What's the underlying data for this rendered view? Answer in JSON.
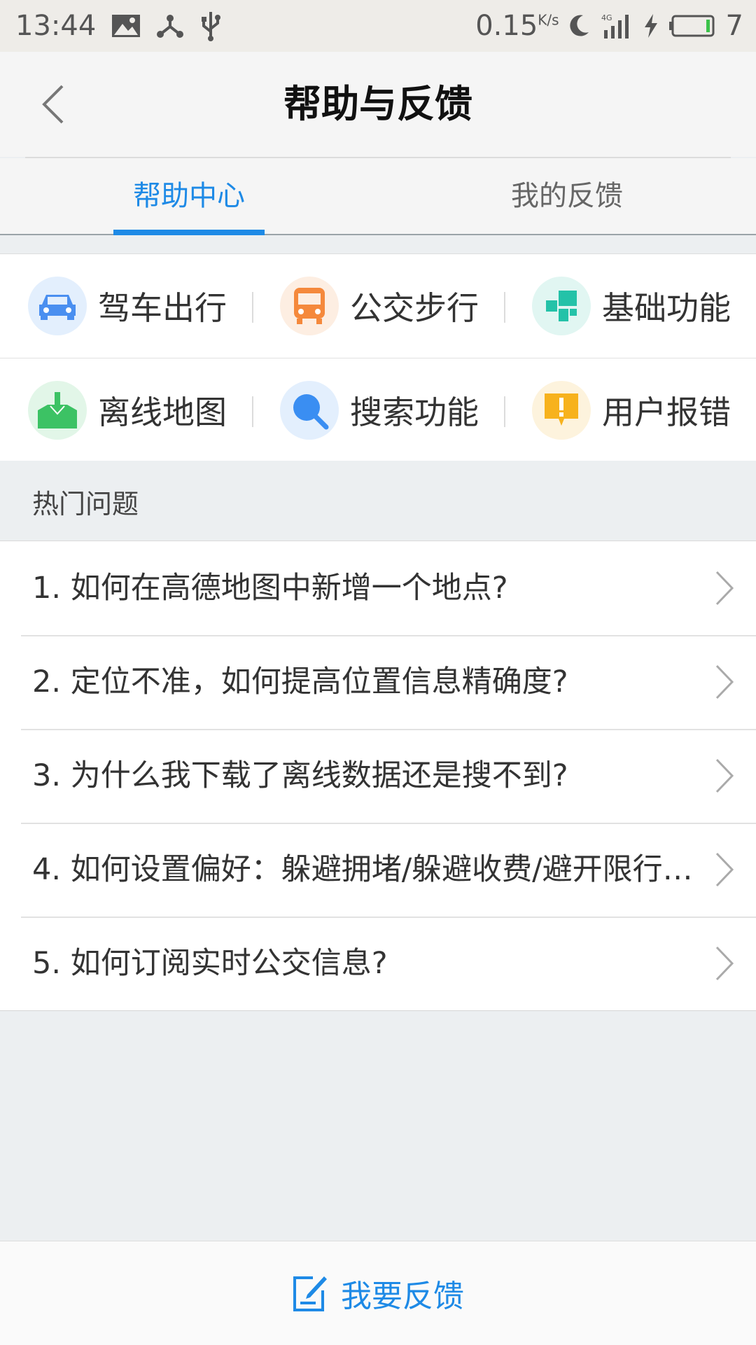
{
  "status_bar": {
    "time": "13:44",
    "speed": "0.15",
    "speed_unit": "K/s",
    "battery": "7",
    "network": "4G",
    "icons": [
      "image-icon",
      "share-node-icon",
      "usb-icon",
      "moon-icon",
      "signal-icon",
      "charging-icon",
      "battery-icon"
    ]
  },
  "header": {
    "title": "帮助与反馈",
    "back_icon": "chevron-left-icon"
  },
  "tabs": [
    {
      "label": "帮助中心",
      "active": true
    },
    {
      "label": "我的反馈",
      "active": false
    }
  ],
  "categories": [
    {
      "label": "驾车出行",
      "icon": "car-icon",
      "color": "#4a8ff0",
      "bg": "#e3effd"
    },
    {
      "label": "公交步行",
      "icon": "bus-icon",
      "color": "#f5893c",
      "bg": "#fdeee2"
    },
    {
      "label": "基础功能",
      "icon": "blocks-icon",
      "color": "#24c2a8",
      "bg": "#e1f6f2"
    },
    {
      "label": "离线地图",
      "icon": "download-map-icon",
      "color": "#3cc264",
      "bg": "#e2f6e8"
    },
    {
      "label": "搜索功能",
      "icon": "search-icon",
      "color": "#3a8ef2",
      "bg": "#e3effd"
    },
    {
      "label": "用户报错",
      "icon": "alert-icon",
      "color": "#f7b21d",
      "bg": "#fdf3dd"
    }
  ],
  "hot_section": {
    "title": "热门问题"
  },
  "questions": [
    "1. 如何在高德地图中新增一个地点?",
    "2. 定位不准，如何提高位置信息精确度?",
    "3. 为什么我下载了离线数据还是搜不到?",
    "4. 如何设置偏好：躲避拥堵/躲避收费/避开限行…",
    "5. 如何订阅实时公交信息?"
  ],
  "feedback_button": {
    "label": "我要反馈",
    "icon": "edit-icon"
  },
  "colors": {
    "accent": "#1e8ae6",
    "background": "#eceff1"
  }
}
